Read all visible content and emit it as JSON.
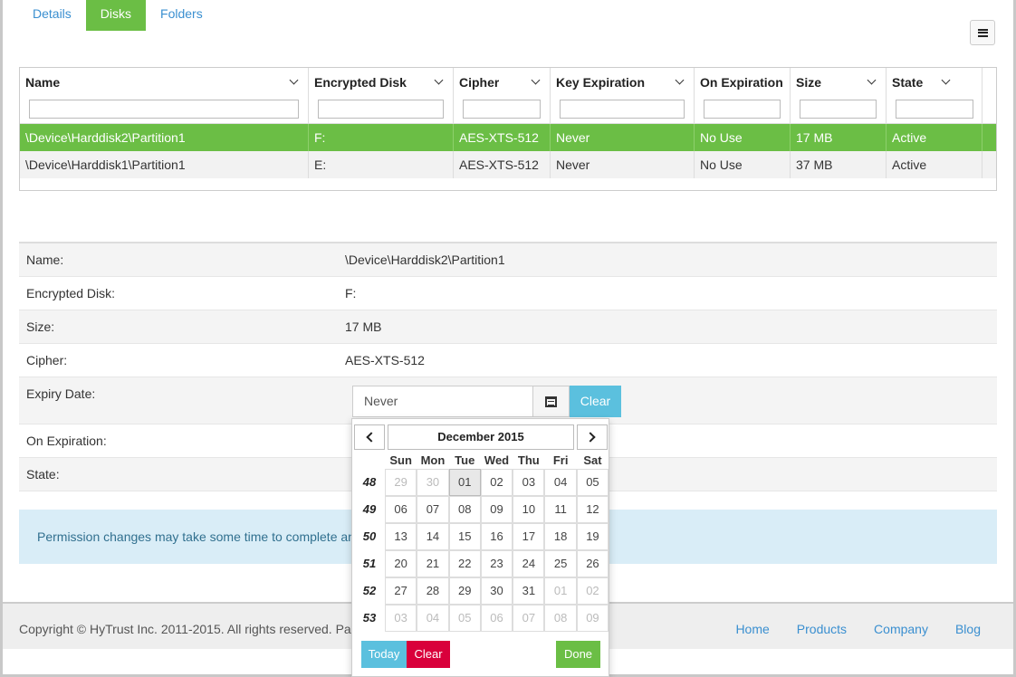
{
  "tabs": [
    {
      "label": "Details",
      "active": false
    },
    {
      "label": "Disks",
      "active": true
    },
    {
      "label": "Folders",
      "active": false
    }
  ],
  "menu_icon": "hamburger-icon",
  "grid": {
    "columns": [
      "Name",
      "Encrypted Disk",
      "Cipher",
      "Key Expiration",
      "On Expiration",
      "Size",
      "State"
    ],
    "rows": [
      [
        "\\Device\\Harddisk2\\Partition1",
        "F:",
        "AES-XTS-512",
        "Never",
        "No Use",
        "17 MB",
        "Active"
      ],
      [
        "\\Device\\Harddisk1\\Partition1",
        "E:",
        "AES-XTS-512",
        "Never",
        "No Use",
        "37 MB",
        "Active"
      ]
    ],
    "selected_row": 0
  },
  "details": {
    "name_label": "Name:",
    "name_value": "\\Device\\Harddisk2\\Partition1",
    "disk_label": "Encrypted Disk:",
    "disk_value": "F:",
    "size_label": "Size:",
    "size_value": "17 MB",
    "cipher_label": "Cipher:",
    "cipher_value": "AES-XTS-512",
    "expiry_label": "Expiry Date:",
    "expiry_value": "Never",
    "expiry_clear": "Clear",
    "onexp_label": "On Expiration:",
    "state_label": "State:"
  },
  "info_text": "Permission changes may take some time to complete and fo",
  "footer": {
    "copyright": "Copyright © HyTrust Inc. 2011-2015. All rights reserved. Pat. 85",
    "links": [
      "Home",
      "Products",
      "Company",
      "Blog"
    ]
  },
  "datepicker": {
    "title": "December 2015",
    "dow": [
      "Sun",
      "Mon",
      "Tue",
      "Wed",
      "Thu",
      "Fri",
      "Sat"
    ],
    "weeks": [
      {
        "wk": "48",
        "days": [
          [
            "29",
            true
          ],
          [
            "30",
            true
          ],
          [
            "01",
            false
          ],
          [
            "02",
            false
          ],
          [
            "03",
            false
          ],
          [
            "04",
            false
          ],
          [
            "05",
            false
          ]
        ]
      },
      {
        "wk": "49",
        "days": [
          [
            "06",
            false
          ],
          [
            "07",
            false
          ],
          [
            "08",
            false
          ],
          [
            "09",
            false
          ],
          [
            "10",
            false
          ],
          [
            "11",
            false
          ],
          [
            "12",
            false
          ]
        ]
      },
      {
        "wk": "50",
        "days": [
          [
            "13",
            false
          ],
          [
            "14",
            false
          ],
          [
            "15",
            false
          ],
          [
            "16",
            false
          ],
          [
            "17",
            false
          ],
          [
            "18",
            false
          ],
          [
            "19",
            false
          ]
        ]
      },
      {
        "wk": "51",
        "days": [
          [
            "20",
            false
          ],
          [
            "21",
            false
          ],
          [
            "22",
            false
          ],
          [
            "23",
            false
          ],
          [
            "24",
            false
          ],
          [
            "25",
            false
          ],
          [
            "26",
            false
          ]
        ]
      },
      {
        "wk": "52",
        "days": [
          [
            "27",
            false
          ],
          [
            "28",
            false
          ],
          [
            "29",
            false
          ],
          [
            "30",
            false
          ],
          [
            "31",
            false
          ],
          [
            "01",
            true
          ],
          [
            "02",
            true
          ]
        ]
      },
      {
        "wk": "53",
        "days": [
          [
            "03",
            true
          ],
          [
            "04",
            true
          ],
          [
            "05",
            true
          ],
          [
            "06",
            true
          ],
          [
            "07",
            true
          ],
          [
            "08",
            true
          ],
          [
            "09",
            true
          ]
        ]
      }
    ],
    "highlighted_day": "01",
    "today_label": "Today",
    "clear_label": "Clear",
    "done_label": "Done"
  },
  "colors": {
    "accent_green": "#6bbe45",
    "info_blue": "#5bc0de",
    "danger_red": "#d9003b",
    "link_blue": "#3a8fd0"
  }
}
